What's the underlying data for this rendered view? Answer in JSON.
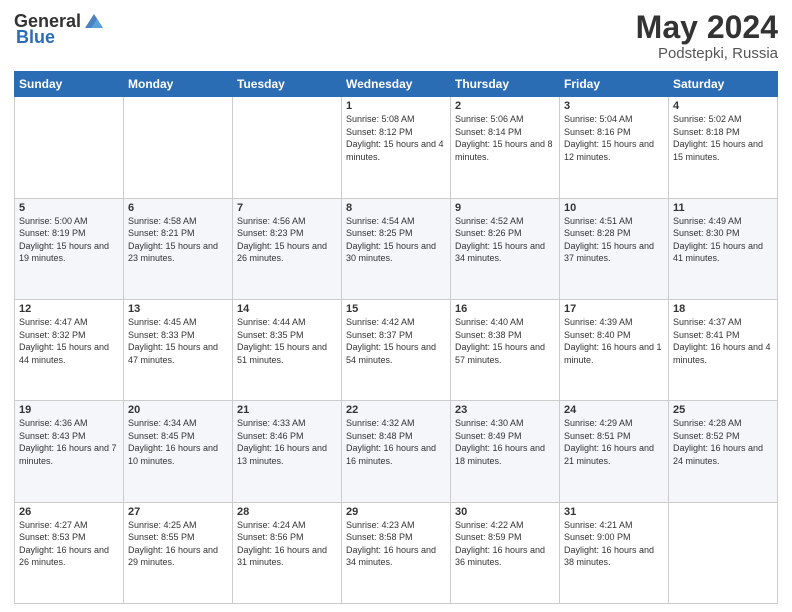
{
  "header": {
    "logo_general": "General",
    "logo_blue": "Blue",
    "title": "May 2024",
    "location": "Podstepki, Russia"
  },
  "weekdays": [
    "Sunday",
    "Monday",
    "Tuesday",
    "Wednesday",
    "Thursday",
    "Friday",
    "Saturday"
  ],
  "weeks": [
    [
      {
        "day": "",
        "sunrise": "",
        "sunset": "",
        "daylight": ""
      },
      {
        "day": "",
        "sunrise": "",
        "sunset": "",
        "daylight": ""
      },
      {
        "day": "",
        "sunrise": "",
        "sunset": "",
        "daylight": ""
      },
      {
        "day": "1",
        "sunrise": "Sunrise: 5:08 AM",
        "sunset": "Sunset: 8:12 PM",
        "daylight": "Daylight: 15 hours and 4 minutes."
      },
      {
        "day": "2",
        "sunrise": "Sunrise: 5:06 AM",
        "sunset": "Sunset: 8:14 PM",
        "daylight": "Daylight: 15 hours and 8 minutes."
      },
      {
        "day": "3",
        "sunrise": "Sunrise: 5:04 AM",
        "sunset": "Sunset: 8:16 PM",
        "daylight": "Daylight: 15 hours and 12 minutes."
      },
      {
        "day": "4",
        "sunrise": "Sunrise: 5:02 AM",
        "sunset": "Sunset: 8:18 PM",
        "daylight": "Daylight: 15 hours and 15 minutes."
      }
    ],
    [
      {
        "day": "5",
        "sunrise": "Sunrise: 5:00 AM",
        "sunset": "Sunset: 8:19 PM",
        "daylight": "Daylight: 15 hours and 19 minutes."
      },
      {
        "day": "6",
        "sunrise": "Sunrise: 4:58 AM",
        "sunset": "Sunset: 8:21 PM",
        "daylight": "Daylight: 15 hours and 23 minutes."
      },
      {
        "day": "7",
        "sunrise": "Sunrise: 4:56 AM",
        "sunset": "Sunset: 8:23 PM",
        "daylight": "Daylight: 15 hours and 26 minutes."
      },
      {
        "day": "8",
        "sunrise": "Sunrise: 4:54 AM",
        "sunset": "Sunset: 8:25 PM",
        "daylight": "Daylight: 15 hours and 30 minutes."
      },
      {
        "day": "9",
        "sunrise": "Sunrise: 4:52 AM",
        "sunset": "Sunset: 8:26 PM",
        "daylight": "Daylight: 15 hours and 34 minutes."
      },
      {
        "day": "10",
        "sunrise": "Sunrise: 4:51 AM",
        "sunset": "Sunset: 8:28 PM",
        "daylight": "Daylight: 15 hours and 37 minutes."
      },
      {
        "day": "11",
        "sunrise": "Sunrise: 4:49 AM",
        "sunset": "Sunset: 8:30 PM",
        "daylight": "Daylight: 15 hours and 41 minutes."
      }
    ],
    [
      {
        "day": "12",
        "sunrise": "Sunrise: 4:47 AM",
        "sunset": "Sunset: 8:32 PM",
        "daylight": "Daylight: 15 hours and 44 minutes."
      },
      {
        "day": "13",
        "sunrise": "Sunrise: 4:45 AM",
        "sunset": "Sunset: 8:33 PM",
        "daylight": "Daylight: 15 hours and 47 minutes."
      },
      {
        "day": "14",
        "sunrise": "Sunrise: 4:44 AM",
        "sunset": "Sunset: 8:35 PM",
        "daylight": "Daylight: 15 hours and 51 minutes."
      },
      {
        "day": "15",
        "sunrise": "Sunrise: 4:42 AM",
        "sunset": "Sunset: 8:37 PM",
        "daylight": "Daylight: 15 hours and 54 minutes."
      },
      {
        "day": "16",
        "sunrise": "Sunrise: 4:40 AM",
        "sunset": "Sunset: 8:38 PM",
        "daylight": "Daylight: 15 hours and 57 minutes."
      },
      {
        "day": "17",
        "sunrise": "Sunrise: 4:39 AM",
        "sunset": "Sunset: 8:40 PM",
        "daylight": "Daylight: 16 hours and 1 minute."
      },
      {
        "day": "18",
        "sunrise": "Sunrise: 4:37 AM",
        "sunset": "Sunset: 8:41 PM",
        "daylight": "Daylight: 16 hours and 4 minutes."
      }
    ],
    [
      {
        "day": "19",
        "sunrise": "Sunrise: 4:36 AM",
        "sunset": "Sunset: 8:43 PM",
        "daylight": "Daylight: 16 hours and 7 minutes."
      },
      {
        "day": "20",
        "sunrise": "Sunrise: 4:34 AM",
        "sunset": "Sunset: 8:45 PM",
        "daylight": "Daylight: 16 hours and 10 minutes."
      },
      {
        "day": "21",
        "sunrise": "Sunrise: 4:33 AM",
        "sunset": "Sunset: 8:46 PM",
        "daylight": "Daylight: 16 hours and 13 minutes."
      },
      {
        "day": "22",
        "sunrise": "Sunrise: 4:32 AM",
        "sunset": "Sunset: 8:48 PM",
        "daylight": "Daylight: 16 hours and 16 minutes."
      },
      {
        "day": "23",
        "sunrise": "Sunrise: 4:30 AM",
        "sunset": "Sunset: 8:49 PM",
        "daylight": "Daylight: 16 hours and 18 minutes."
      },
      {
        "day": "24",
        "sunrise": "Sunrise: 4:29 AM",
        "sunset": "Sunset: 8:51 PM",
        "daylight": "Daylight: 16 hours and 21 minutes."
      },
      {
        "day": "25",
        "sunrise": "Sunrise: 4:28 AM",
        "sunset": "Sunset: 8:52 PM",
        "daylight": "Daylight: 16 hours and 24 minutes."
      }
    ],
    [
      {
        "day": "26",
        "sunrise": "Sunrise: 4:27 AM",
        "sunset": "Sunset: 8:53 PM",
        "daylight": "Daylight: 16 hours and 26 minutes."
      },
      {
        "day": "27",
        "sunrise": "Sunrise: 4:25 AM",
        "sunset": "Sunset: 8:55 PM",
        "daylight": "Daylight: 16 hours and 29 minutes."
      },
      {
        "day": "28",
        "sunrise": "Sunrise: 4:24 AM",
        "sunset": "Sunset: 8:56 PM",
        "daylight": "Daylight: 16 hours and 31 minutes."
      },
      {
        "day": "29",
        "sunrise": "Sunrise: 4:23 AM",
        "sunset": "Sunset: 8:58 PM",
        "daylight": "Daylight: 16 hours and 34 minutes."
      },
      {
        "day": "30",
        "sunrise": "Sunrise: 4:22 AM",
        "sunset": "Sunset: 8:59 PM",
        "daylight": "Daylight: 16 hours and 36 minutes."
      },
      {
        "day": "31",
        "sunrise": "Sunrise: 4:21 AM",
        "sunset": "Sunset: 9:00 PM",
        "daylight": "Daylight: 16 hours and 38 minutes."
      },
      {
        "day": "",
        "sunrise": "",
        "sunset": "",
        "daylight": ""
      }
    ]
  ]
}
